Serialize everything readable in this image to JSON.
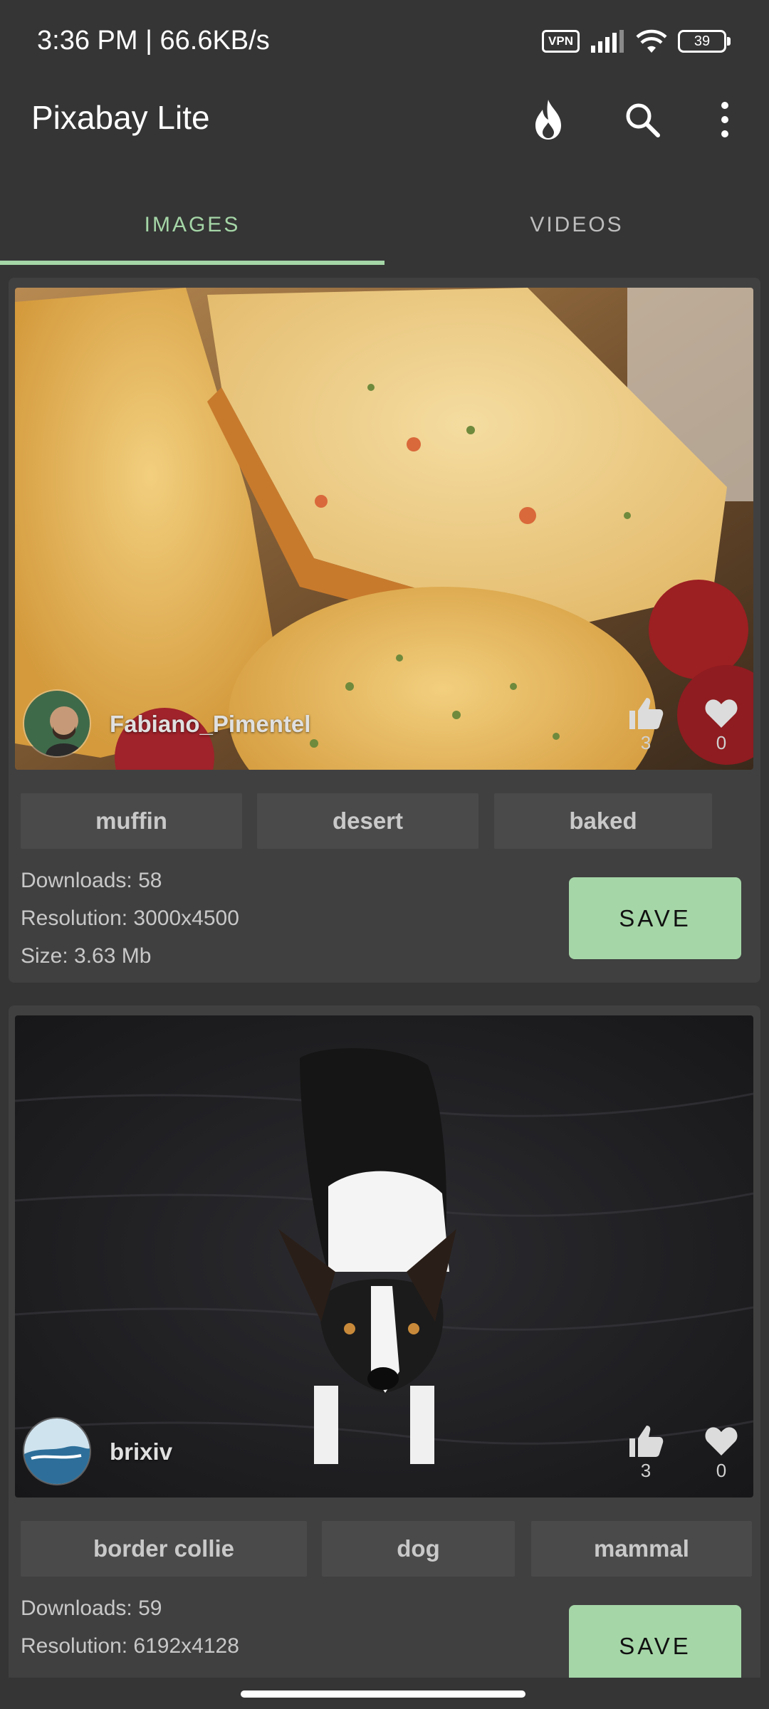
{
  "status_bar": {
    "time_speed": "3:36 PM | 66.6KB/s",
    "vpn": "VPN",
    "battery": "39"
  },
  "app_bar": {
    "title": "Pixabay Lite",
    "actions": [
      "fire-icon",
      "search-icon",
      "more-vert-icon"
    ]
  },
  "tabs": [
    {
      "label": "IMAGES",
      "active": true
    },
    {
      "label": "VIDEOS",
      "active": false
    }
  ],
  "accent_color": "#a5d6a7",
  "cards": [
    {
      "username": "Fabiano_Pimentel",
      "likes": "3",
      "favorites": "0",
      "tags": [
        "muffin",
        "desert",
        "baked"
      ],
      "downloads": "Downloads: 58",
      "resolution": "Resolution: 3000x4500",
      "size": "Size: 3.63 Mb",
      "save_label": "SAVE"
    },
    {
      "username": "brixiv",
      "likes": "3",
      "favorites": "0",
      "tags": [
        "border collie",
        "dog",
        "mammal"
      ],
      "downloads": "Downloads: 59",
      "resolution": "Resolution: 6192x4128",
      "save_label": "SAVE"
    }
  ]
}
